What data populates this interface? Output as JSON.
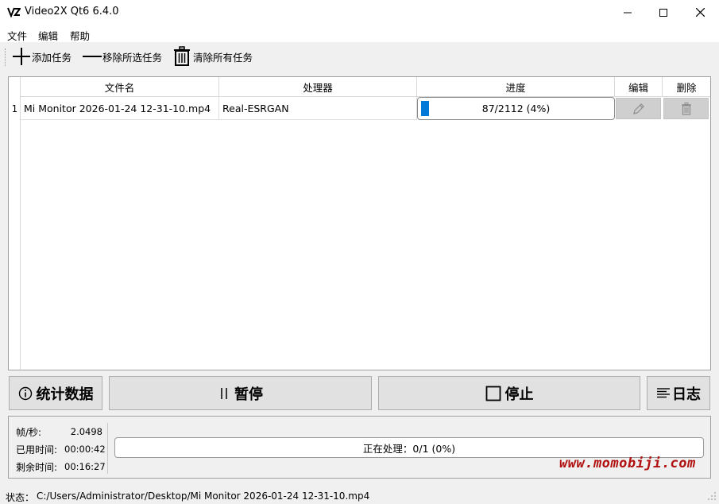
{
  "window": {
    "title": "Video2X Qt6 6.4.0",
    "logo_text": "VZ"
  },
  "menu": [
    "文件",
    "编辑",
    "帮助"
  ],
  "toolbar": {
    "add_task": "添加任务",
    "remove_selected": "移除所选任务",
    "clear_all": "清除所有任务"
  },
  "table": {
    "headers": {
      "filename": "文件名",
      "processor": "处理器",
      "progress": "进度",
      "edit": "编辑",
      "delete": "删除"
    },
    "rows": [
      {
        "index": "1",
        "filename": "Mi Monitor 2026-01-24 12-31-10.mp4",
        "processor": "Real-ESRGAN",
        "progress_text": "87/2112 (4%)",
        "progress_fraction": 0.04
      }
    ]
  },
  "buttons": {
    "stats": "统计数据",
    "pause": "暂停",
    "stop": "停止",
    "log": "日志"
  },
  "stats": {
    "fps_label": "帧/秒:",
    "fps_value": "2.0498",
    "elapsed_label": "已用时间:",
    "elapsed_value": "00:00:42",
    "remaining_label": "剩余时间:",
    "remaining_value": "00:16:27",
    "overall_text": "正在处理：0/1 (0%)",
    "overall_fraction": 0
  },
  "watermark": "www.momobiji.com",
  "statusbar": {
    "label": "状态：",
    "path": "C:/Users/Administrator/Desktop/Mi Monitor 2026-01-24 12-31-10.mp4"
  },
  "colors": {
    "accent": "#0078d7",
    "watermark": "#b01010"
  }
}
